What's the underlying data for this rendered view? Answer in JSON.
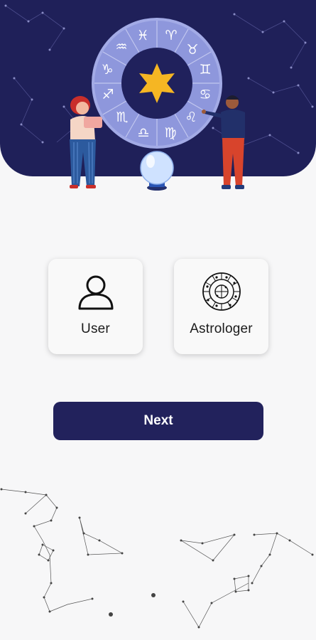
{
  "hero": {
    "illustration": "zodiac-wheel-with-people",
    "colors": {
      "background": "#1f2059",
      "wheel": "#8e97dc",
      "star": "#f5b623"
    },
    "zodiac_icons": [
      "pisces-icon",
      "aries-icon",
      "taurus-icon",
      "gemini-icon",
      "cancer-icon",
      "leo-icon",
      "virgo-icon",
      "libra-icon",
      "scorpio-icon",
      "sagittarius-icon",
      "capricorn-icon",
      "aquarius-icon"
    ]
  },
  "roles": [
    {
      "label": "User",
      "icon": "user-icon"
    },
    {
      "label": "Astrologer",
      "icon": "zodiac-chart-icon"
    }
  ],
  "next_button": {
    "label": "Next",
    "color": "#22225c"
  }
}
